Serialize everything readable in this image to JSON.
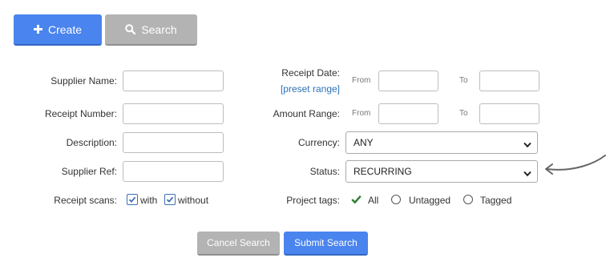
{
  "toolbar": {
    "create_label": "Create",
    "search_label": "Search"
  },
  "form": {
    "supplier_name": {
      "label": "Supplier Name:",
      "value": ""
    },
    "receipt_number": {
      "label": "Receipt Number:",
      "value": ""
    },
    "description": {
      "label": "Description:",
      "value": ""
    },
    "supplier_ref": {
      "label": "Supplier Ref:",
      "value": ""
    },
    "receipt_scans": {
      "label": "Receipt scans:",
      "options": [
        {
          "label": "with",
          "checked": true
        },
        {
          "label": "without",
          "checked": true
        }
      ]
    },
    "receipt_date": {
      "label": "Receipt Date:",
      "preset_link": "[preset range]",
      "from_label": "From",
      "to_label": "To",
      "from_value": "",
      "to_value": ""
    },
    "amount_range": {
      "label": "Amount Range:",
      "from_label": "From",
      "to_label": "To",
      "from_value": "",
      "to_value": ""
    },
    "currency": {
      "label": "Currency:",
      "value": "ANY"
    },
    "status": {
      "label": "Status:",
      "value": "RECURRING"
    },
    "project_tags": {
      "label": "Project tags:",
      "options": [
        {
          "label": "All",
          "selected": true
        },
        {
          "label": "Untagged",
          "selected": false
        },
        {
          "label": "Tagged",
          "selected": false
        }
      ]
    }
  },
  "actions": {
    "cancel_label": "Cancel Search",
    "submit_label": "Submit Search"
  },
  "colors": {
    "primary": "#4a84ee",
    "secondary": "#b3b3b3",
    "link": "#2f73b8",
    "check": "#2e7d32"
  }
}
